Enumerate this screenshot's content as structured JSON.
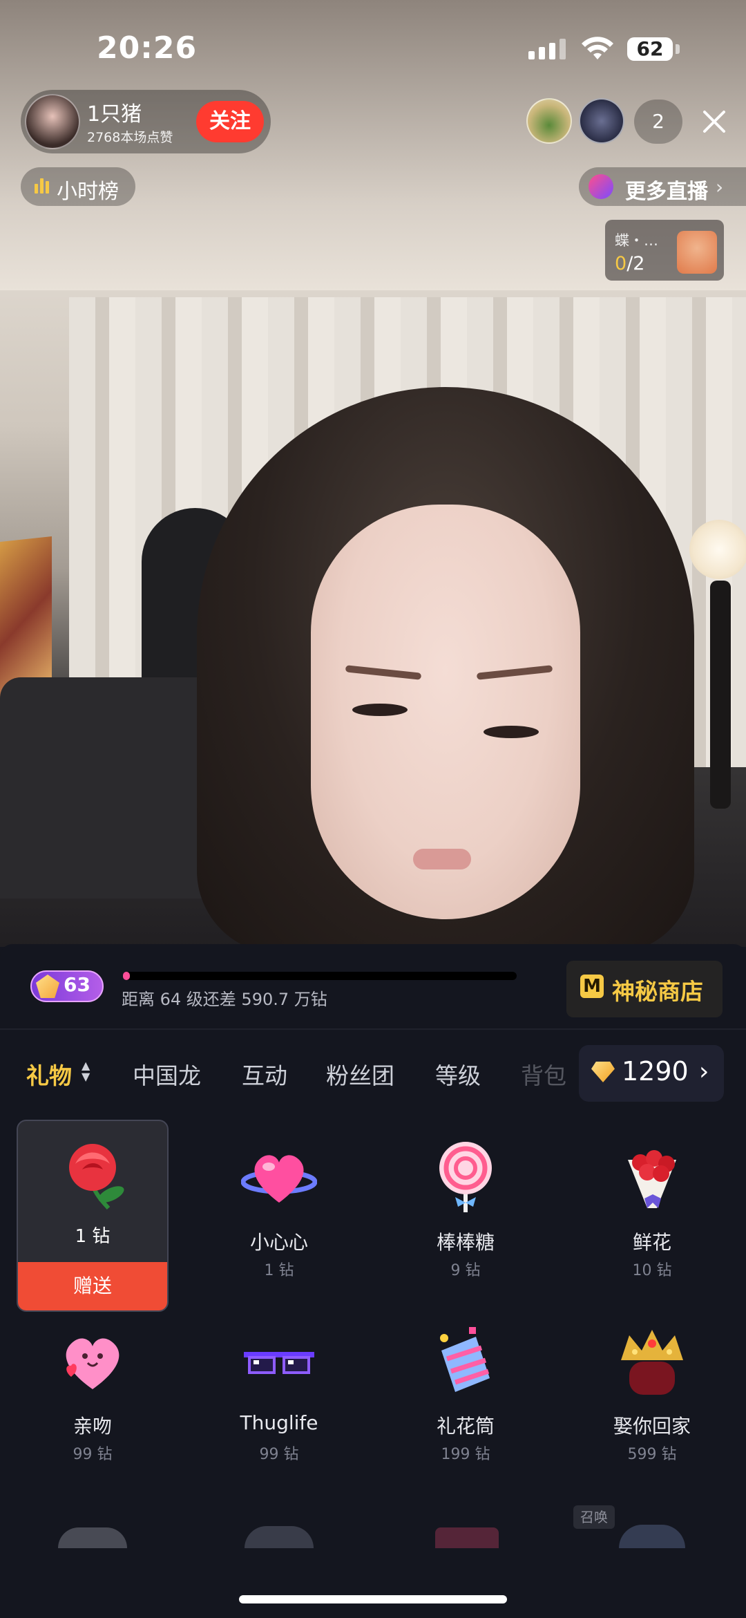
{
  "status_bar": {
    "time": "20:26",
    "battery": "62"
  },
  "host": {
    "name": "1只猪",
    "likes": "2768本场点赞",
    "follow_label": "关注"
  },
  "viewers": {
    "count": "2"
  },
  "top_left_badge": {
    "label": "小时榜"
  },
  "top_right_link": {
    "label": "更多直播"
  },
  "task": {
    "title": "蝶・…",
    "progress_done": "0",
    "progress_total": "/2"
  },
  "level": {
    "badge_number": "63",
    "progress_fraction": 0.01,
    "text": "距离 64 级还差 590.7 万钻"
  },
  "shop": {
    "icon_text": "M",
    "label": "神秘商店"
  },
  "tabs": [
    "礼物",
    "中国龙",
    "互动",
    "粉丝团",
    "等级",
    "背包"
  ],
  "wallet": {
    "balance": "1290"
  },
  "gifts": [
    {
      "name": "",
      "price": "1 钻",
      "icon": "rose-icon",
      "selected": true,
      "send_label": "赠送"
    },
    {
      "name": "小心心",
      "price": "1 钻",
      "icon": "heart-icon"
    },
    {
      "name": "棒棒糖",
      "price": "9 钻",
      "icon": "lollipop-icon"
    },
    {
      "name": "鲜花",
      "price": "10 钻",
      "icon": "bouquet-icon"
    },
    {
      "name": "亲吻",
      "price": "99 钻",
      "icon": "kiss-heart-icon"
    },
    {
      "name": "Thuglife",
      "price": "99 钻",
      "icon": "pixel-sunglasses-icon"
    },
    {
      "name": "礼花筒",
      "price": "199 钻",
      "icon": "party-popper-icon"
    },
    {
      "name": "娶你回家",
      "price": "599 钻",
      "icon": "bridal-crown-icon"
    }
  ],
  "summon_label": "召唤",
  "colors": {
    "accent_gold": "#f6c945",
    "follow_red": "#ff3b30",
    "send_orange": "#f04c35"
  }
}
